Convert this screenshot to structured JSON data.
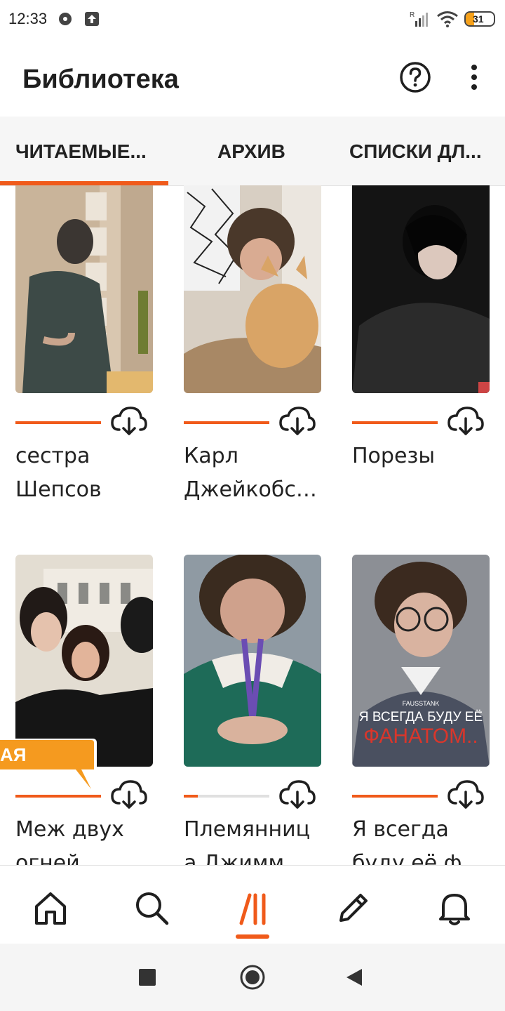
{
  "status_bar": {
    "time": "12:33",
    "battery": "31"
  },
  "app_bar": {
    "title": "Библиотека",
    "help_icon": "help-circle-icon",
    "more_icon": "more-vert-icon"
  },
  "tabs": [
    {
      "label": "ЧИТАЕМЫЕ..."
    },
    {
      "label": "АРХИВ"
    },
    {
      "label": "СПИСКИ ДЛ..."
    }
  ],
  "accent_color": "#f05a1a",
  "stories": [
    {
      "title_lines": [
        "сестра",
        "Шепсов"
      ],
      "progress": 1.0
    },
    {
      "title_lines": [
        "Карл",
        "Джейкобс…"
      ],
      "progress": 1.0
    },
    {
      "title_lines": [
        "Порезы"
      ],
      "progress": 1.0
    },
    {
      "title_lines": [
        "Меж двух",
        "огней"
      ],
      "progress": 1.0,
      "badge": "АЯ"
    },
    {
      "title_lines": [
        "Племянниц",
        "а Джимм"
      ],
      "progress": 0.16
    },
    {
      "title_lines": [
        "Я всегда",
        "буду её ф"
      ],
      "progress": 1.0,
      "cover_text": [
        "FAUSSTANK",
        "Я ВСЕГДА БУДУ ЕЁ",
        "ФАНАТОМ.."
      ]
    }
  ],
  "bottom_nav": [
    {
      "name": "home-icon"
    },
    {
      "name": "search-icon"
    },
    {
      "name": "library-icon",
      "active": true
    },
    {
      "name": "write-icon"
    },
    {
      "name": "notifications-icon"
    }
  ],
  "system_nav": [
    "recents-square-icon",
    "home-circle-icon",
    "back-triangle-icon"
  ]
}
